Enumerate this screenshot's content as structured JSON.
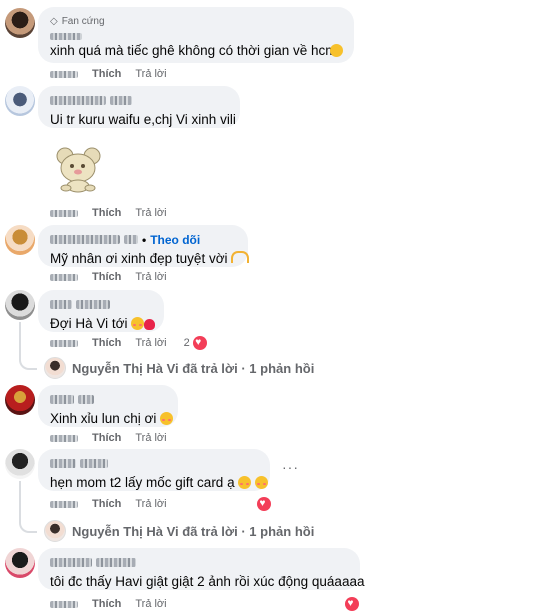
{
  "comments": [
    {
      "badge": "Fan cứng",
      "text": "xinh quá mà tiếc ghê không có thời gian về hcm",
      "like": "Thích",
      "reply": "Trả lời"
    },
    {
      "text": "Ui tr kuru waifu e,chj Vi xinh vili",
      "like": "Thích",
      "reply": "Trả lời"
    },
    {
      "like": "Thích",
      "reply": "Trả lời"
    },
    {
      "follow": "Theo dõi",
      "text": "Mỹ nhân ơi xinh đẹp tuyệt vời",
      "like": "Thích",
      "reply": "Trả lời"
    },
    {
      "text": "Đợi Hà Vi tới",
      "like": "Thích",
      "reply": "Trả lời",
      "reaction_count": "2",
      "thread_reply": "Nguyễn Thị Hà Vi đã trả lời · 1 phản hồi"
    },
    {
      "text": "Xinh xỉu lun chị ơi",
      "like": "Thích",
      "reply": "Trả lời"
    },
    {
      "text": "hẹn mom t2 lấy mốc gift card ạ",
      "like": "Thích",
      "reply": "Trả lời",
      "more": "···",
      "thread_reply": "Nguyễn Thị Hà Vi đã trả lời · 1 phản hồi"
    },
    {
      "text": "tôi đc thấy Havi giật giật 2 ảnh rồi xúc động quáaaaa",
      "like": "Thích",
      "reply": "Trả lời"
    }
  ],
  "icons": {
    "diamond": "diamond-icon",
    "heart": "heart-reaction-icon",
    "emoji": "emoji-icon",
    "sticker": "bear-sticker"
  },
  "colors": {
    "bubble": "#f0f2f5",
    "meta_text": "#65676b",
    "link": "#0064d1",
    "heart": "#f33e58"
  }
}
